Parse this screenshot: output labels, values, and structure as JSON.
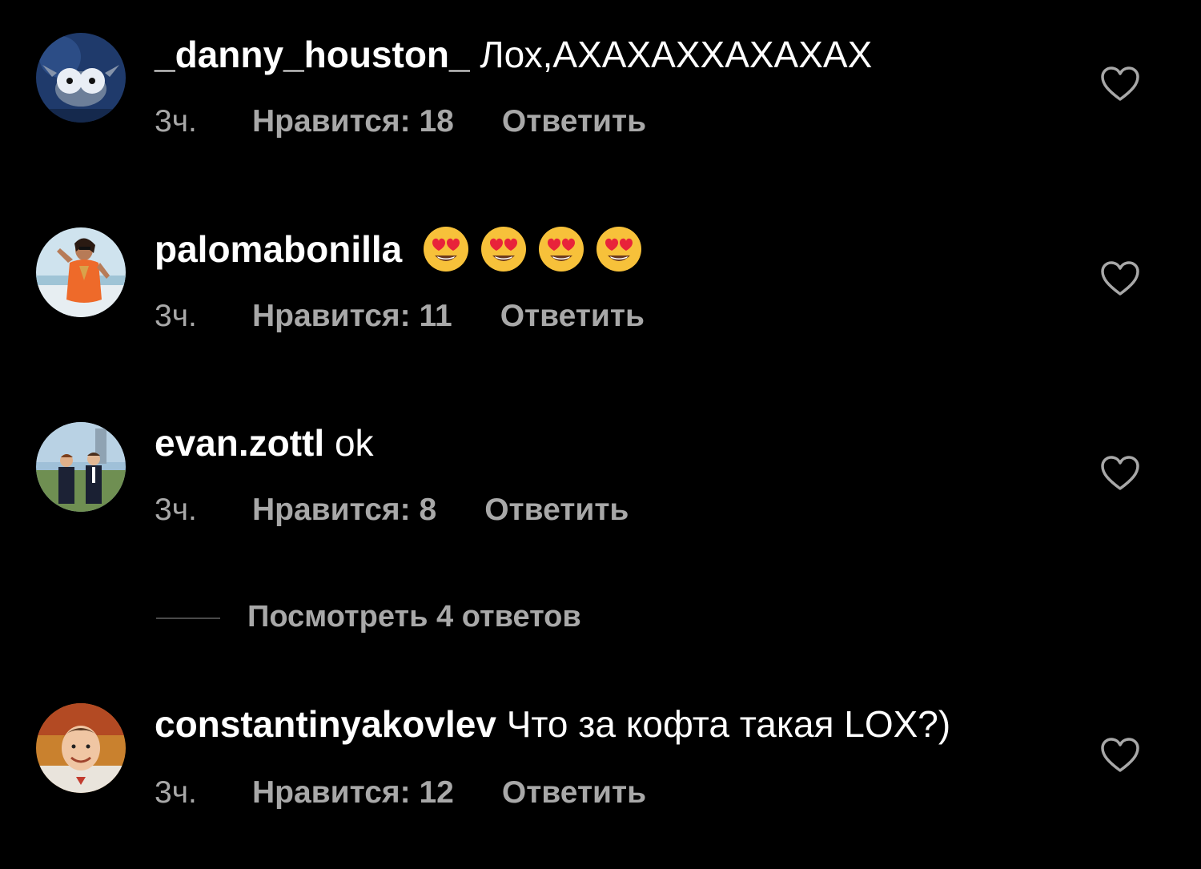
{
  "comments": [
    {
      "username": "_danny_houston_",
      "text": "Лох,АХАХАХХАХАХАХ",
      "time": "3ч.",
      "likes": "Нравится: 18",
      "reply": "Ответить"
    },
    {
      "username": "palomabonilla",
      "text": "",
      "emojis": [
        "heart-eyes-emoji",
        "heart-eyes-emoji",
        "heart-eyes-emoji",
        "heart-eyes-emoji"
      ],
      "time": "3ч.",
      "likes": "Нравится: 11",
      "reply": "Ответить"
    },
    {
      "username": "evan.zottl",
      "text": "ok",
      "time": "3ч.",
      "likes": "Нравится: 8",
      "reply": "Ответить"
    },
    {
      "username": "constantinyakovlev",
      "text": "Что за кофта такая LOX?)",
      "time": "3ч.",
      "likes": "Нравится: 12",
      "reply": "Ответить"
    }
  ],
  "view_replies": "Посмотреть 4 ответов",
  "icons": {
    "like": "heart-outline-icon"
  },
  "colors": {
    "background": "#000000",
    "primary_text": "#ffffff",
    "secondary_text": "#a8a8a8"
  }
}
